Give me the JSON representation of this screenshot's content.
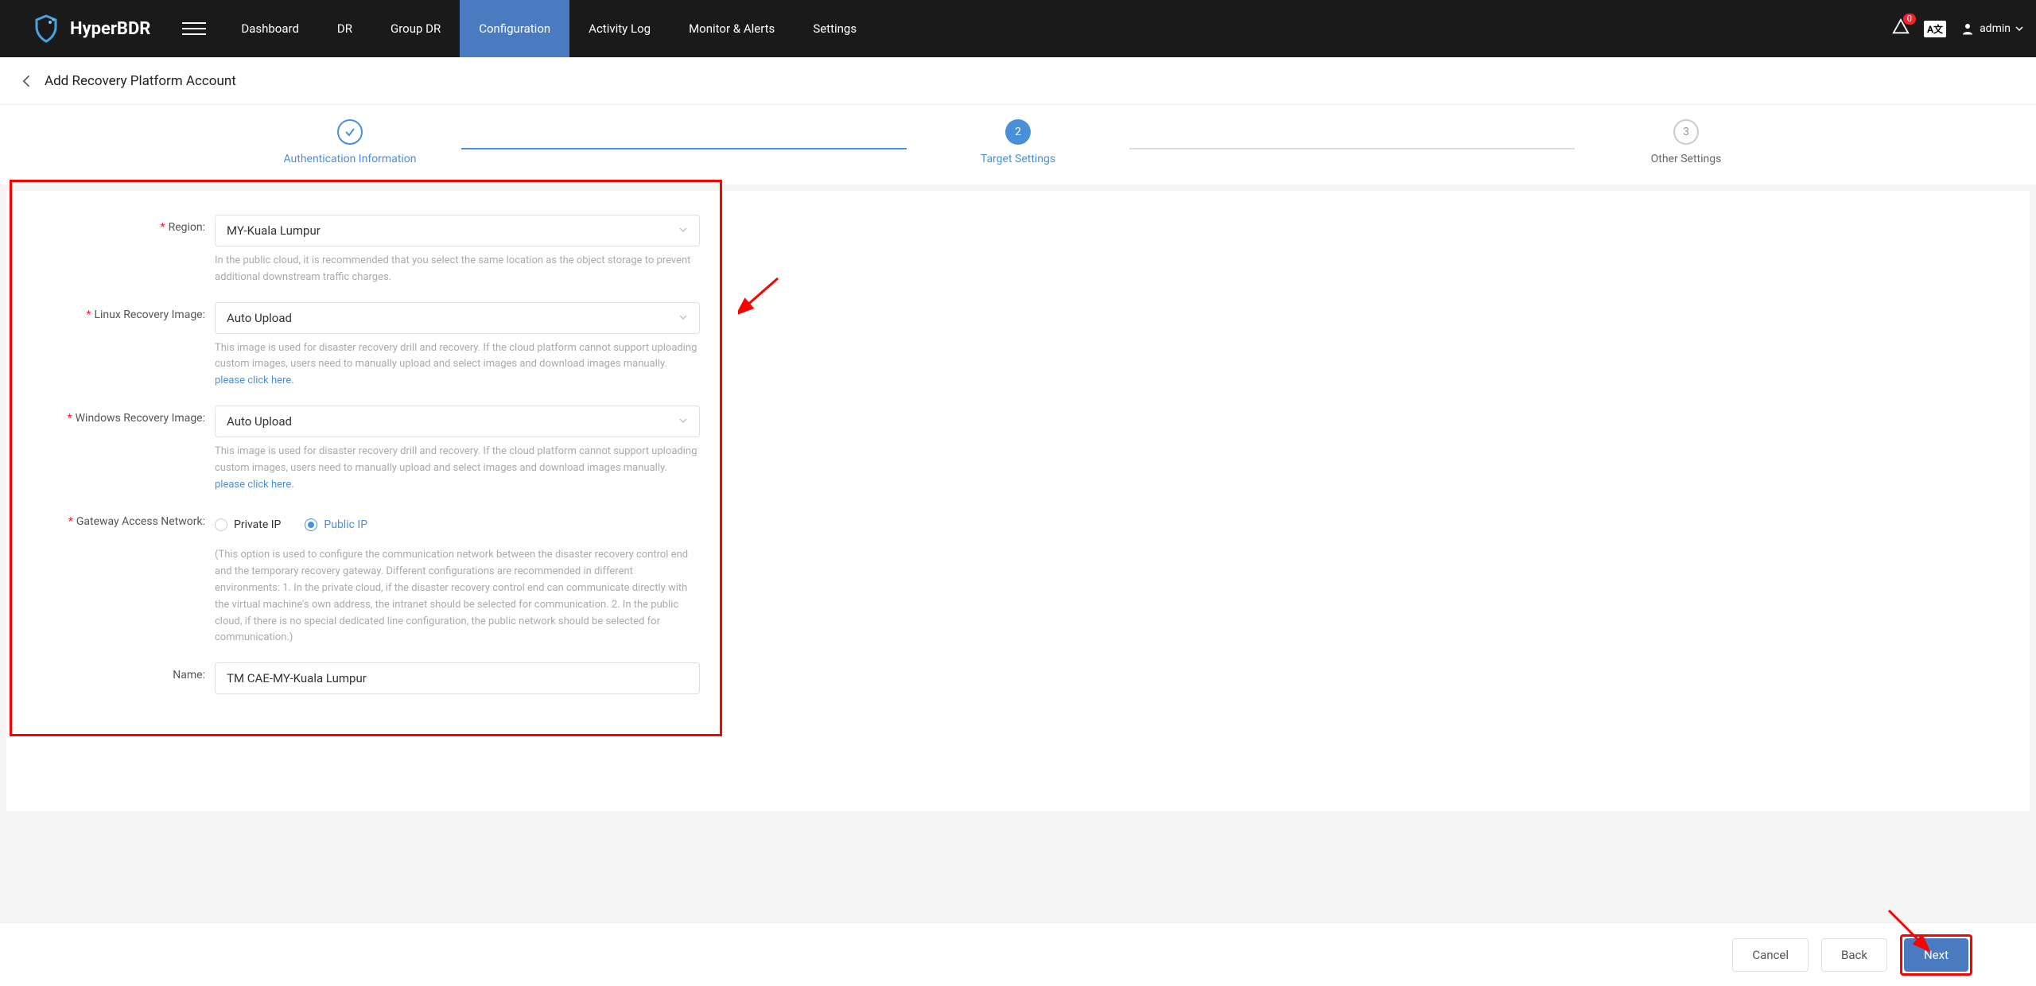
{
  "brand": "HyperBDR",
  "nav": {
    "items": [
      "Dashboard",
      "DR",
      "Group DR",
      "Configuration",
      "Activity Log",
      "Monitor & Alerts",
      "Settings"
    ],
    "active_index": 3,
    "notif_badge": "0",
    "lang_badge": "A文",
    "user": "admin"
  },
  "subheader": {
    "title": "Add Recovery Platform Account"
  },
  "stepper": {
    "steps": [
      {
        "label": "Authentication Information",
        "state": "done"
      },
      {
        "label": "Target Settings",
        "state": "active",
        "num": "2"
      },
      {
        "label": "Other Settings",
        "state": "pending",
        "num": "3"
      }
    ]
  },
  "form": {
    "region": {
      "label": "Region:",
      "value": "MY-Kuala Lumpur",
      "hint": "In the public cloud, it is recommended that you select the same location as the object storage to prevent additional downstream traffic charges."
    },
    "linux_image": {
      "label": "Linux Recovery Image:",
      "value": "Auto Upload",
      "hint": "This image is used for disaster recovery drill and recovery. If the cloud platform cannot support uploading custom images, users need to manually upload and select images and download images manually. ",
      "link": "please click here."
    },
    "windows_image": {
      "label": "Windows Recovery Image:",
      "value": "Auto Upload",
      "hint": "This image is used for disaster recovery drill and recovery. If the cloud platform cannot support uploading custom images, users need to manually upload and select images and download images manually. ",
      "link": "please click here."
    },
    "gateway": {
      "label": "Gateway Access Network:",
      "options": {
        "private": "Private IP",
        "public": "Public IP"
      },
      "selected": "public",
      "hint": "(This option is used to configure the communication network between the disaster recovery control end and the temporary recovery gateway. Different configurations are recommended in different environments: 1. In the private cloud, if the disaster recovery control end can communicate directly with the virtual machine's own address, the intranet should be selected for communication. 2. In the public cloud, if there is no special dedicated line configuration, the public network should be selected for communication.)"
    },
    "name": {
      "label": "Name:",
      "value": "TM CAE-MY-Kuala Lumpur"
    }
  },
  "footer": {
    "cancel": "Cancel",
    "back": "Back",
    "next": "Next"
  }
}
